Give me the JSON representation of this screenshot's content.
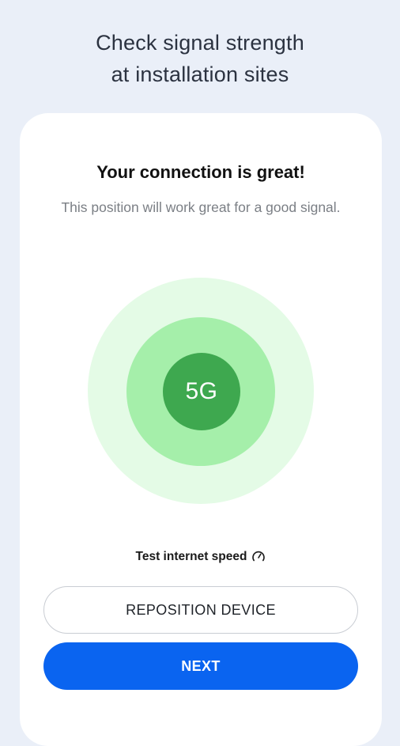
{
  "headline": {
    "line1": "Check signal strength",
    "line2": "at installation sites"
  },
  "card": {
    "title": "Your connection is great!",
    "subtitle": "This position will work great for a good signal."
  },
  "signal": {
    "label": "5G",
    "colors": {
      "outer": "#e4fbe6",
      "middle": "#a5efaa",
      "inner": "#3ea84f"
    }
  },
  "speed_test": {
    "label": "Test internet speed",
    "icon": "speedometer-icon"
  },
  "buttons": {
    "reposition": "REPOSITION DEVICE",
    "next": "NEXT"
  },
  "colors": {
    "background": "#eaeff8",
    "primary": "#0a64f0"
  }
}
